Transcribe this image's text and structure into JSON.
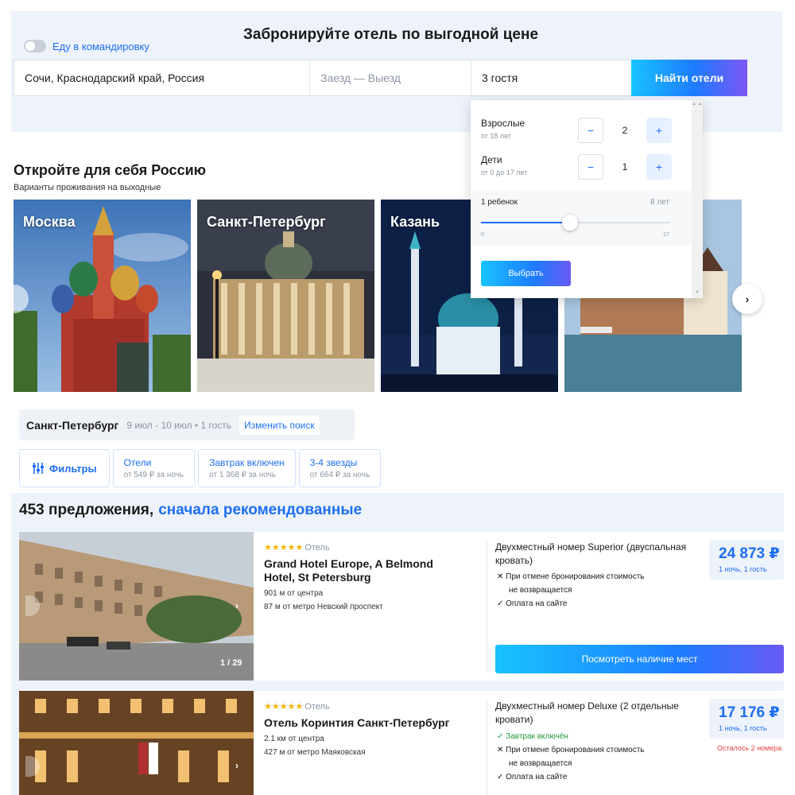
{
  "hero": {
    "title": "Забронируйте отель по выгодной цене",
    "business_trip_label": "Еду в командировку",
    "destination_value": "Сочи, Краснодарский край, Россия",
    "dates_placeholder": "Заезд — Выезд",
    "guests_value": "3 гостя",
    "search_button": "Найти отели"
  },
  "guests_popup": {
    "adults_label": "Взрослые",
    "adults_sub": "от 18 лет",
    "adults_count": "2",
    "children_label": "Дети",
    "children_sub": "от 0 до 17 лет",
    "children_count": "1",
    "minus": "−",
    "plus": "+",
    "child_label": "1 ребенок",
    "child_age_text": "8 лет",
    "slider_min": "0",
    "slider_max": "17",
    "slider_value": 8,
    "select_button": "Выбрать"
  },
  "discover": {
    "title": "Откройте для себя Россию",
    "subtitle": "Варианты проживания на выходные",
    "cities": [
      "Москва",
      "Санкт-Петербург",
      "Казань",
      ""
    ],
    "next_arrow": "›"
  },
  "search_summary": {
    "city": "Санкт-Петербург",
    "meta": "9 июл - 10 июл • 1 гость",
    "change_button": "Изменить поиск"
  },
  "filters": {
    "filters_button": "Фильтры",
    "chips": [
      {
        "title": "Отели",
        "price": "от 549 ₽ за ночь"
      },
      {
        "title": "Завтрак включен",
        "price": "от 1 368 ₽ за ночь"
      },
      {
        "title": "3-4 звезды",
        "price": "от 664 ₽ за ночь"
      }
    ]
  },
  "results": {
    "count": "453 предложения,",
    "sort": "сначала рекомендованные"
  },
  "hotels": [
    {
      "stars": "★★★★★",
      "kind": "Отель",
      "name": "Grand Hotel Europe, A Belmond Hotel, St Petersburg",
      "distance": "901 м от центра",
      "metro": "87 м от метро Невский проспект",
      "photo_counter": "1 / 29",
      "room": "Двухместный номер Superior (двуспальная кровать)",
      "cancel_line1": "✕ При отмене бронирования стоимость",
      "cancel_line2": "не возвращается",
      "payment": "✓ Оплата на сайте",
      "price": "24 873 ₽",
      "price_note": "1 ночь, 1 гость",
      "button": "Посмотреть наличие мест"
    },
    {
      "stars": "★★★★★",
      "kind": "Отель",
      "name": "Отель Коринтия Санкт-Петербург",
      "distance": "2.1 км от центра",
      "metro": "427 м от метро Маяковская",
      "room": "Двухместный номер Deluxe (2 отдельные кровати)",
      "breakfast": "✓ Завтрак включён",
      "cancel_line1": "✕ При отмене бронирования стоимость",
      "cancel_line2": "не возвращается",
      "payment": "✓ Оплата на сайте",
      "price": "17 176 ₽",
      "price_note": "1 ночь, 1 гость",
      "rooms_left": "Осталось 2 номера"
    }
  ],
  "colors": {
    "accent": "#1d6ef5",
    "band": "#eef3fb",
    "star": "#f5b400",
    "green": "#1f9a3b",
    "warning": "#e64040"
  }
}
